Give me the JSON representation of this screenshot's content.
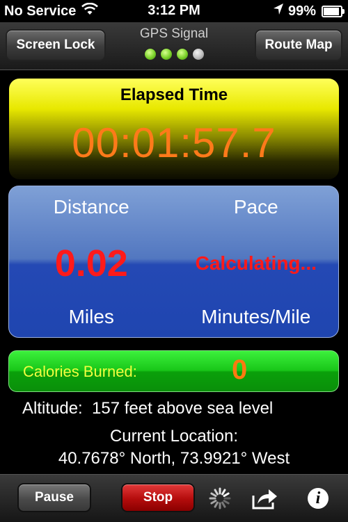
{
  "status_bar": {
    "carrier": "No Service",
    "time": "3:12 PM",
    "battery_percent": "99",
    "battery_level": 0.99,
    "icons": [
      "wifi-icon",
      "location-arrow-icon",
      "battery-icon"
    ]
  },
  "toolbar": {
    "left_button": "Screen Lock",
    "right_button": "Route Map",
    "gps_label": "GPS Signal",
    "gps_signal_strength": 3,
    "gps_signal_max": 4
  },
  "elapsed": {
    "label": "Elapsed Time",
    "value": "00:01:57.7"
  },
  "stats": {
    "distance_label": "Distance",
    "distance_value": "0.02",
    "distance_unit": "Miles",
    "pace_label": "Pace",
    "pace_value": "Calculating...",
    "pace_unit": "Minutes/Mile"
  },
  "calories": {
    "label": "Calories Burned:",
    "value": "0"
  },
  "altitude": {
    "text": "Altitude:  157 feet above sea level"
  },
  "location": {
    "label": "Current Location:",
    "value": "40.7678° North, 73.9921° West"
  },
  "bottom_bar": {
    "pause_label": "Pause",
    "stop_label": "Stop",
    "icons": [
      "activity-spinner-icon",
      "share-icon",
      "info-icon"
    ]
  },
  "colors": {
    "elapsed_time": "#ff7a1a",
    "distance_value": "#ff1a1a",
    "calories_label": "#f0ff40",
    "calories_value": "#ff7a10",
    "gps_on": "#7ad12a"
  }
}
